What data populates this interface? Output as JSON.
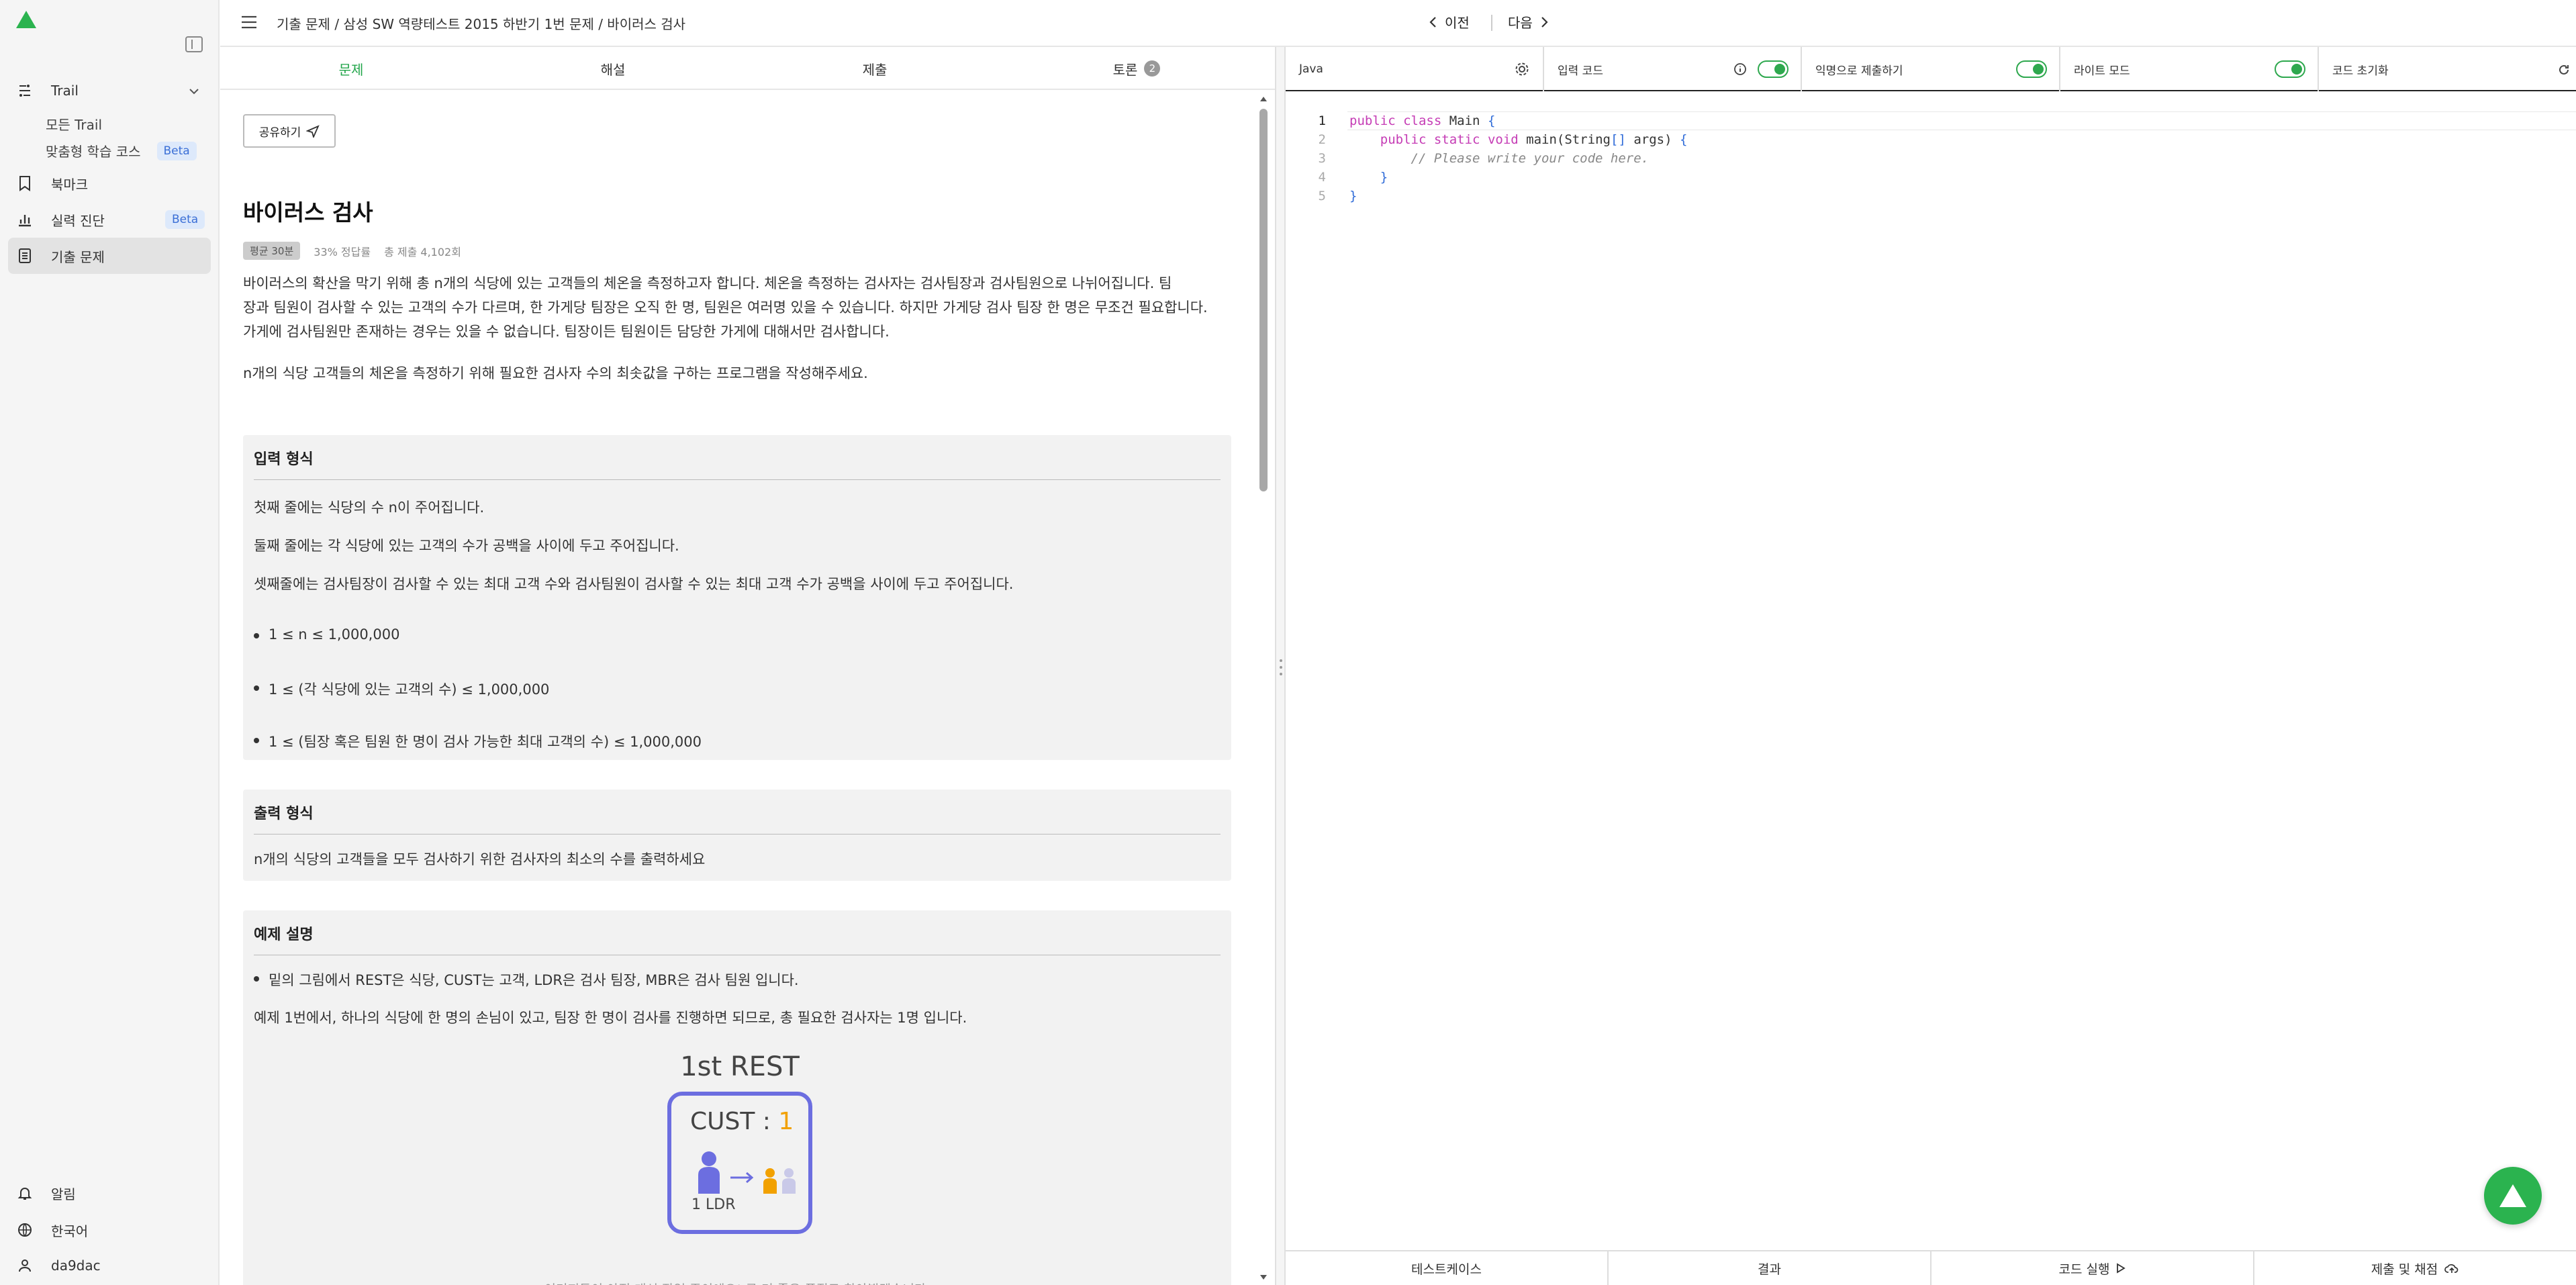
{
  "sidebar": {
    "trail": "Trail",
    "all_trail": "모든 Trail",
    "custom_course": "맞춤형 학습 코스",
    "beta": "Beta",
    "bookmark": "북마크",
    "diagnosis": "실력 진단",
    "past_problems": "기출 문제",
    "alerts": "알림",
    "language": "한국어",
    "user": "da9dac"
  },
  "header": {
    "breadcrumb": "기출 문제 / 삼성 SW 역량테스트 2015 하반기 1번 문제 / 바이러스 검사",
    "prev": "이전",
    "next": "다음"
  },
  "tabs": {
    "problem": "문제",
    "solution": "해설",
    "submit": "제출",
    "discussion": "토론",
    "discussion_count": "2"
  },
  "problem": {
    "share": "공유하기",
    "title": "바이러스 검사",
    "avg": "평균 30분",
    "rate": "33% 정답률",
    "total": "총 제출 4,102회",
    "desc1_l1": "바이러스의 확산을 막기 위해 총 n개의 식당에 있는 고객들의 체온을 측정하고자 합니다. 체온을 측정하는 검사자는 검사팀장과 검사팀원으로 나뉘어집니다. 팀",
    "desc1_l2": "장과 팀원이 검사할 수 있는 고객의 수가 다르며, 한 가게당 팀장은 오직 한 명, 팀원은 여러명 있을 수 있습니다. 하지만 가게당 검사 팀장 한 명은 무조건 필요합니다.",
    "desc1_l3": "가게에 검사팀원만 존재하는 경우는 있을 수 없습니다. 팀장이든 팀원이든 담당한 가게에 대해서만 검사합니다.",
    "desc2": "n개의 식당 고객들의 체온을 측정하기 위해 필요한 검사자 수의 최솟값을 구하는 프로그램을 작성해주세요.",
    "input_title": "입력 형식",
    "input_l1": "첫째 줄에는 식당의 수 n이 주어집니다.",
    "input_l2": "둘째 줄에는 각 식당에 있는 고객의 수가 공백을 사이에 두고 주어집니다.",
    "input_l3": "셋째줄에는 검사팀장이 검사할 수 있는 최대 고객 수와 검사팀원이 검사할 수 있는 최대 고객 수가 공백을 사이에 두고 주어집니다.",
    "c1": "1 ≤ n ≤ 1,000,000",
    "c2": "1 ≤ (각 식당에 있는 고객의 수) ≤ 1,000,000",
    "c3": "1 ≤ (팀장 혹은 팀원 한 명이 검사 가능한 최대 고객의 수) ≤ 1,000,000",
    "output_title": "출력 형식",
    "output_l1": "n개의 식당의 고객들을 모두 검사하기 위한 검사자의 최소의 수를 출력하세요",
    "example_title": "예제 설명",
    "ex_l1": "밑의 그림에서 REST은 식당, CUST는 고객, LDR은 검사 팀장, MBR은 검사 팀원 입니다.",
    "ex_l2": "예제 1번에서, 하나의 식당에 한 명의 손님이 있고, 팀장 한 명이 검사를 진행하면 되므로, 총 필요한 검사자는 1명 입니다.",
    "fig_title": "1st REST",
    "fig_cust": "CUST : ",
    "fig_cust_n": "1",
    "fig_ldr": "1 LDR",
    "fig_caption": "이미지들이 아직 개선 작업 중이에요! 곧 더 좋은 품질로 찾아뵙겠습니다."
  },
  "editor": {
    "language": "Java",
    "input_code": "입력 코드",
    "anonymous": "익명으로 제출하기",
    "light_mode": "라이트 모드",
    "reset": "코드 초기화",
    "lines": [
      "1",
      "2",
      "3",
      "4",
      "5"
    ]
  },
  "bottom": {
    "testcase": "테스트케이스",
    "result": "결과",
    "run": "코드 실행",
    "grade": "제출 및 채점"
  }
}
